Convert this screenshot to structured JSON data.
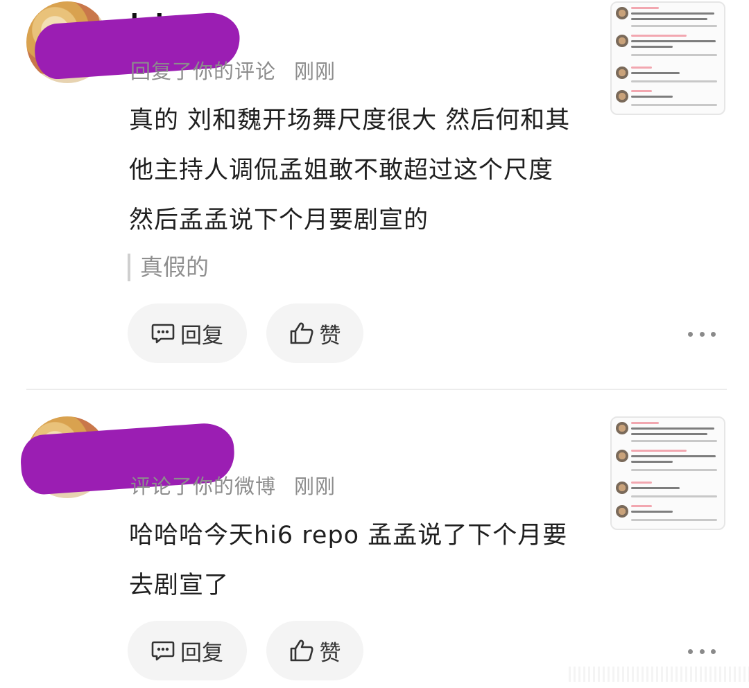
{
  "notifications": [
    {
      "meta_action": "回复了你的评论",
      "meta_time": "刚刚",
      "body": "真的 刘和魏开场舞尺度很大 然后何和其他主持人调侃孟姐敢不敢超过这个尺度 然后孟孟说下个月要剧宣的",
      "quote": "真假的",
      "reply_label": "回复",
      "like_label": "赞"
    },
    {
      "meta_action": "评论了你的微博",
      "meta_time": "刚刚",
      "body": "哈哈哈今天hi6 repo 孟孟说了下个月要去剧宣了",
      "reply_label": "回复",
      "like_label": "赞"
    }
  ],
  "icons": {
    "reply": "comment-bubble-icon",
    "like": "thumbs-up-icon",
    "more": "more-dots-icon"
  },
  "colors": {
    "redaction": "#9b1eb3",
    "meta_text": "#8c8c8c",
    "pill_bg": "#f4f4f4"
  }
}
